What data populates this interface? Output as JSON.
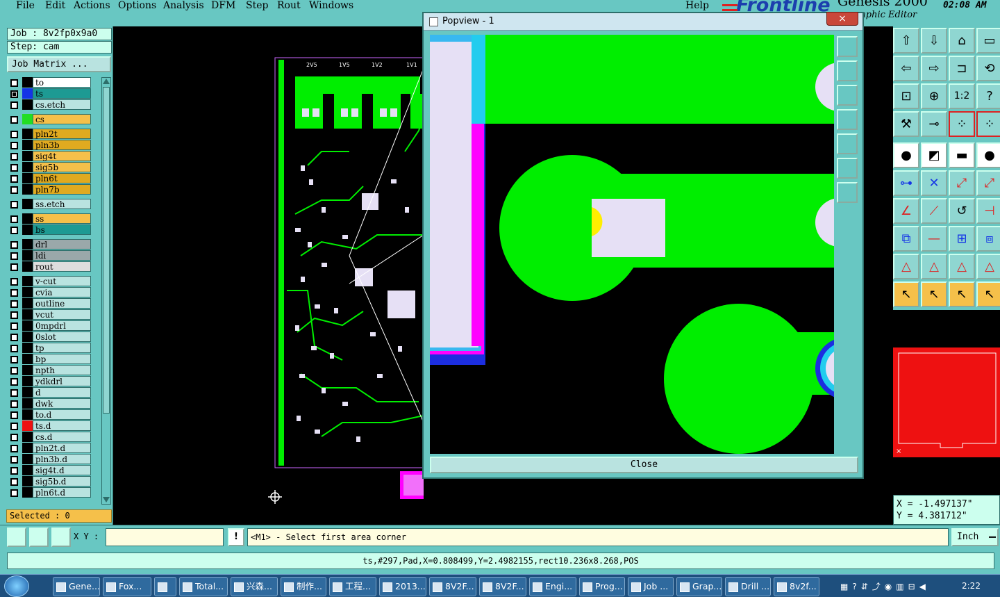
{
  "menu": [
    "File",
    "Edit",
    "Actions",
    "Options",
    "Analysis",
    "DFM",
    "Step",
    "Rout",
    "Windows"
  ],
  "help": "Help",
  "brand": {
    "logo": "Frontline",
    "product": "Genesis 2000",
    "subtitle": "Graphic Editor",
    "subtitle_visible": "aphic Editor",
    "clock": "02:08 AM",
    "close_glyph": "×"
  },
  "job": {
    "job_label": "Job : 8v2fp0x9a0",
    "step_label": "Step: cam",
    "matrix_button": "Job Matrix ..."
  },
  "layers": [
    {
      "name": "to",
      "color": "#ffffff",
      "swatch": "#000000",
      "checked": false
    },
    {
      "name": "ts",
      "color": "#1d9a93",
      "swatch": "#1434e6",
      "checked": true
    },
    {
      "name": "cs.etch",
      "color": "#b9e3e0",
      "swatch": "#000000",
      "checked": false
    },
    {
      "name": "cs",
      "color": "#f5c04a",
      "swatch": "#22dd22",
      "checked": false
    },
    {
      "name": "pln2t",
      "color": "#e0aa20",
      "swatch": "#000000",
      "checked": false
    },
    {
      "name": "pln3b",
      "color": "#e0aa20",
      "swatch": "#000000",
      "checked": false
    },
    {
      "name": "sig4t",
      "color": "#f5c04a",
      "swatch": "#000000",
      "checked": false
    },
    {
      "name": "sig5b",
      "color": "#f5c04a",
      "swatch": "#000000",
      "checked": false
    },
    {
      "name": "pln6t",
      "color": "#e0aa20",
      "swatch": "#000000",
      "checked": false
    },
    {
      "name": "pln7b",
      "color": "#e0aa20",
      "swatch": "#000000",
      "checked": false
    },
    {
      "name": "ss.etch",
      "color": "#b9e3e0",
      "swatch": "#000000",
      "checked": false
    },
    {
      "name": "ss",
      "color": "#f5c04a",
      "swatch": "#000000",
      "checked": false
    },
    {
      "name": "bs",
      "color": "#1d9a93",
      "swatch": "#000000",
      "checked": false
    },
    {
      "name": "drl",
      "color": "#9aa8aa",
      "swatch": "#000000",
      "checked": false
    },
    {
      "name": "ldi",
      "color": "#9aa8aa",
      "swatch": "#000000",
      "checked": false
    },
    {
      "name": "rout",
      "color": "#dddddd",
      "swatch": "#000000",
      "checked": false
    },
    {
      "name": "v-cut",
      "color": "#b9e3e0",
      "swatch": "#000000",
      "checked": false
    },
    {
      "name": "cvia",
      "color": "#b9e3e0",
      "swatch": "#000000",
      "checked": false
    },
    {
      "name": "outline",
      "color": "#b9e3e0",
      "swatch": "#000000",
      "checked": false
    },
    {
      "name": "vcut",
      "color": "#b9e3e0",
      "swatch": "#000000",
      "checked": false
    },
    {
      "name": "0mpdrl",
      "color": "#b9e3e0",
      "swatch": "#000000",
      "checked": false
    },
    {
      "name": "0slot",
      "color": "#b9e3e0",
      "swatch": "#000000",
      "checked": false
    },
    {
      "name": "tp",
      "color": "#b9e3e0",
      "swatch": "#000000",
      "checked": false
    },
    {
      "name": "bp",
      "color": "#b9e3e0",
      "swatch": "#000000",
      "checked": false
    },
    {
      "name": "npth",
      "color": "#b9e3e0",
      "swatch": "#000000",
      "checked": false
    },
    {
      "name": "ydkdrl",
      "color": "#b9e3e0",
      "swatch": "#000000",
      "checked": false
    },
    {
      "name": "d",
      "color": "#b9e3e0",
      "swatch": "#000000",
      "checked": false
    },
    {
      "name": "dwk",
      "color": "#b9e3e0",
      "swatch": "#000000",
      "checked": false
    },
    {
      "name": "to.d",
      "color": "#b9e3e0",
      "swatch": "#000000",
      "checked": false
    },
    {
      "name": "ts.d",
      "color": "#b9e3e0",
      "swatch": "#ee1111",
      "checked": false
    },
    {
      "name": "cs.d",
      "color": "#b9e3e0",
      "swatch": "#000000",
      "checked": false
    },
    {
      "name": "pln2t.d",
      "color": "#b9e3e0",
      "swatch": "#000000",
      "checked": false
    },
    {
      "name": "pln3b.d",
      "color": "#b9e3e0",
      "swatch": "#000000",
      "checked": false
    },
    {
      "name": "sig4t.d",
      "color": "#b9e3e0",
      "swatch": "#000000",
      "checked": false
    },
    {
      "name": "sig5b.d",
      "color": "#b9e3e0",
      "swatch": "#000000",
      "checked": false
    },
    {
      "name": "pln6t.d",
      "color": "#b9e3e0",
      "swatch": "#000000",
      "checked": false
    }
  ],
  "selected": "Selected : 0",
  "board_labels": [
    "2V5",
    "1V5",
    "1V2",
    "1V1"
  ],
  "popup": {
    "title": "Popview - 1",
    "close": "Close",
    "close_glyph": "×"
  },
  "coords": {
    "x": "X = -1.497137\"",
    "y": "Y = 4.381712\""
  },
  "cmd": {
    "xy_label": "X Y :",
    "xy_value": "",
    "bang": "!",
    "prompt": "<M1> - Select first area corner",
    "units": "Inch"
  },
  "status": "ts,#297,Pad,X=0.808499,Y=2.4982155,rect10.236x8.268,POS",
  "taskbar": {
    "items": [
      "Gene...",
      "Fox...",
      "",
      "Total...",
      "兴森...",
      "制作...",
      "工程...",
      "2013...",
      "8V2F...",
      "8V2F...",
      "Engi...",
      "Prog...",
      "Job ...",
      "Grap...",
      "Drill ...",
      "8v2f..."
    ],
    "time": "2:22"
  },
  "colors": {
    "panel": "#68c7c2",
    "copper": "#00ee00",
    "pad": "#e6e0f5",
    "mask": "#ff00ff",
    "selected": "#f5c04a"
  }
}
